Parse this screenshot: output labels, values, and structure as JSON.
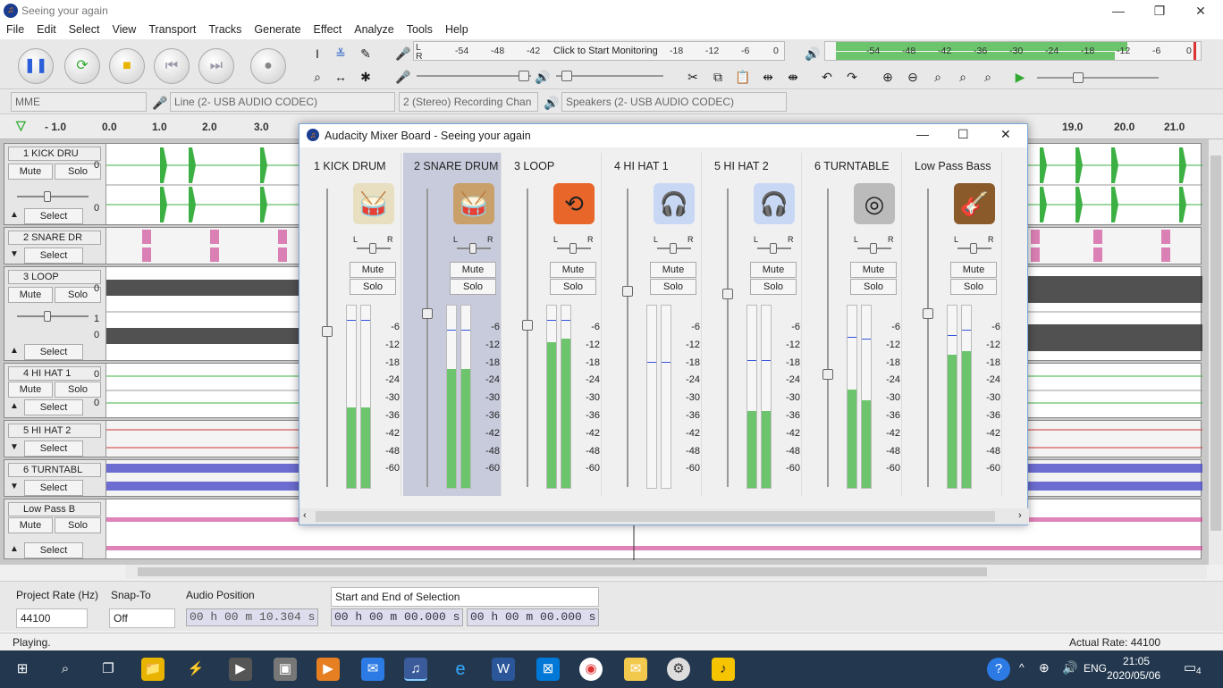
{
  "window": {
    "title": "Seeing your again"
  },
  "menu": [
    "File",
    "Edit",
    "Select",
    "View",
    "Transport",
    "Tracks",
    "Generate",
    "Effect",
    "Analyze",
    "Tools",
    "Help"
  ],
  "meters": {
    "rec_ticks": [
      "-54",
      "-48",
      "-42",
      "Click to Start Monitoring",
      "-18",
      "-12",
      "-6",
      "0"
    ],
    "play_ticks": [
      "-54",
      "-48",
      "-42",
      "-36",
      "-30",
      "-24",
      "-18",
      "-12",
      "-6",
      "0"
    ],
    "rec_label_l": "L",
    "rec_label_r": "R"
  },
  "devices": {
    "host": "MME",
    "input": "Line (2- USB AUDIO  CODEC)",
    "channels": "2 (Stereo) Recording Chan",
    "output": "Speakers (2- USB AUDIO  CODEC)"
  },
  "ruler": [
    "- 1.0",
    "0.0",
    "1.0",
    "2.0",
    "3.0",
    "19.0",
    "20.0",
    "21.0"
  ],
  "tracks": [
    {
      "name": "1 KICK DRU",
      "mute": "Mute",
      "solo": "Solo",
      "select": "Select",
      "ch": [
        "0",
        "0"
      ]
    },
    {
      "name": "2 SNARE DR",
      "select": "Select"
    },
    {
      "name": "3 LOOP",
      "mute": "Mute",
      "solo": "Solo",
      "select": "Select",
      "ch": [
        "0",
        "1",
        "0"
      ]
    },
    {
      "name": "4 HI HAT 1",
      "mute": "Mute",
      "solo": "Solo",
      "select": "Select",
      "ch": [
        "0",
        "0"
      ]
    },
    {
      "name": "5 HI HAT 2",
      "select": "Select"
    },
    {
      "name": "6 TURNTABL",
      "select": "Select"
    },
    {
      "name": "Low Pass B",
      "mute": "Mute",
      "solo": "Solo",
      "select": "Select"
    }
  ],
  "mixer": {
    "title": "Audacity Mixer Board - Seeing your again",
    "pan_l": "L",
    "pan_r": "R",
    "mute": "Mute",
    "solo": "Solo",
    "scale": [
      "-6",
      "-12",
      "-18",
      "-24",
      "-30",
      "-36",
      "-42",
      "-48",
      "-60"
    ],
    "strips": [
      {
        "name": "1 KICK DRUM",
        "icon": "drum-icon",
        "level": [
          0.44,
          0.44
        ],
        "peak": [
          0.92,
          0.92
        ],
        "gain": 0.52
      },
      {
        "name": "2 SNARE DRUM",
        "icon": "snare-icon",
        "level": [
          0.65,
          0.65
        ],
        "peak": [
          0.87,
          0.87
        ],
        "gain": 0.58,
        "selected": true
      },
      {
        "name": "3 LOOP",
        "icon": "loop-icon",
        "level": [
          0.8,
          0.82
        ],
        "peak": [
          0.92,
          0.92
        ],
        "gain": 0.54
      },
      {
        "name": "4 HI HAT 1",
        "icon": "headphones-icon",
        "level": [
          0,
          0
        ],
        "peak": [
          0.69,
          0.69
        ],
        "gain": 0.66
      },
      {
        "name": "5 HI HAT 2",
        "icon": "headphones-icon",
        "level": [
          0.42,
          0.42
        ],
        "peak": [
          0.7,
          0.7
        ],
        "gain": 0.65
      },
      {
        "name": "6 TURNTABLE",
        "icon": "turntable-icon",
        "level": [
          0.54,
          0.48
        ],
        "peak": [
          0.83,
          0.82
        ],
        "gain": 0.37
      },
      {
        "name": "Low Pass Bass",
        "icon": "guitar-icon",
        "level": [
          0.73,
          0.75
        ],
        "peak": [
          0.84,
          0.87
        ],
        "gain": 0.58
      }
    ]
  },
  "selection": {
    "rate_label": "Project Rate (Hz)",
    "rate": "44100",
    "snap_label": "Snap-To",
    "snap": "Off",
    "pos_label": "Audio Position",
    "pos": "00 h 00 m 10.304 s",
    "sel_mode": "Start and End of Selection",
    "start": "00 h 00 m 00.000 s",
    "end": "00 h 00 m 00.000 s"
  },
  "status": {
    "left": "Playing.",
    "right": "Actual Rate: 44100"
  },
  "clock": {
    "time": "21:05",
    "date": "2020/05/06",
    "lang": "ENG",
    "notif": "4"
  },
  "colors": {
    "wave_green": "#3cb043",
    "meter_green": "#6cc46c",
    "selected_strip": "#c8cbdc",
    "taskbar": "#23384f"
  }
}
